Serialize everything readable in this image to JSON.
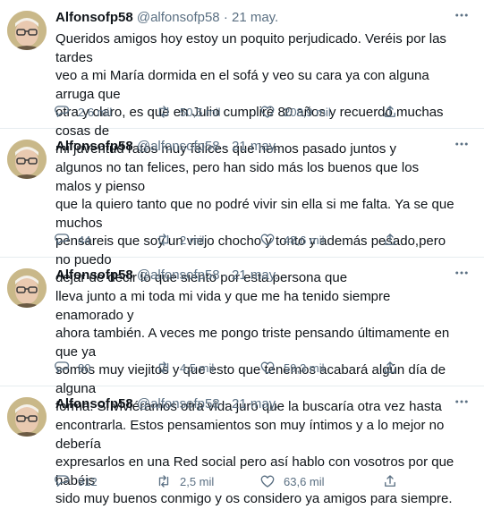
{
  "tweets": [
    {
      "name": "Alfonsofp58",
      "handle": "@alfonsofp58",
      "separator": "·",
      "date": "21 may.",
      "text": "Queridos amigos hoy estoy un poquito perjudicado. Veréis por las tardes\nveo a mi María dormida en el sofá y veo su cara ya con alguna arruga que\notra y claro, es que en Julio cumpliré 80  años y recuerdo muchas cosas de\nmi juventud ratos muy felices que hemos pasado juntos y",
      "replies": "2,6 mil",
      "retweets": "50,5 mil",
      "likes": "208,9 mil"
    },
    {
      "name": "Alfonsofp58",
      "handle": "@alfonsofp58",
      "separator": "·",
      "date": "21 may.",
      "text": "algunos no tan felices, pero han sido más los buenos que los malos y pienso\nque la quiero tanto que no podré vivir sin ella si me falta. Ya se que muchos\npensareis que soy un viejo chocho y tonto y además pesado,pero no puedo\ndejar de decir lo que siento por esta persona que",
      "replies": "44",
      "retweets": "2 mil",
      "likes": "48,6 mil"
    },
    {
      "name": "Alfonsofp58",
      "handle": "@alfonsofp58",
      "separator": "·",
      "date": "21 may.",
      "text": "lleva junto a mi toda mi vida y que me ha tenido siempre enamorado y\nahora también. A veces me pongo triste pensando últimamente en que ya\nsomos muy viejitos y que esto que tenemos acabará algún día de alguna\nforma. Si viviéramos otra vida juro que la buscaría otra vez hasta",
      "replies": "80",
      "retweets": "4,5 mil",
      "likes": "59,3 mil"
    },
    {
      "name": "Alfonsofp58",
      "handle": "@alfonsofp58",
      "separator": "·",
      "date": "21 may.",
      "text": "encontrarla. Estos pensamientos son muy íntimos y a lo mejor no debería\nexpresarlos en una Red social pero así hablo con vosotros por que habéis\nsido muy buenos conmigo y os considero ya amigos para siempre.",
      "replies": "912",
      "retweets": "2,5 mil",
      "likes": "63,6 mil"
    }
  ],
  "icons": {
    "more": "more-dots-icon",
    "reply": "reply-icon",
    "retweet": "retweet-icon",
    "like": "heart-icon",
    "share": "share-icon"
  },
  "colors": {
    "text": "#0f1419",
    "secondary": "#5b7083",
    "divider": "#e6ecf0"
  }
}
